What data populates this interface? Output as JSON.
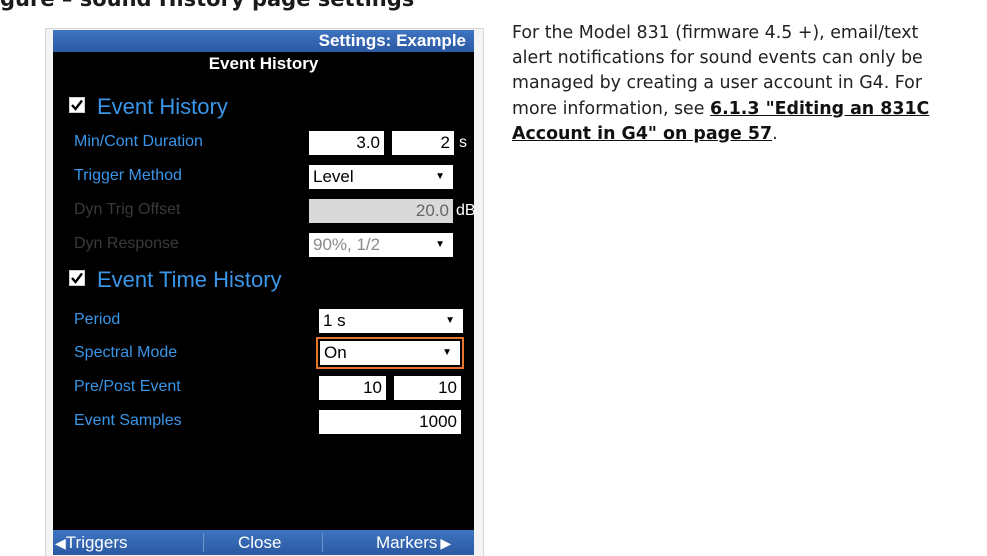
{
  "heading_fragment": "gure  –  sound  History page settings",
  "device": {
    "title": "Settings: Example",
    "subtitle": "Event History",
    "event_history": {
      "section_label": "Event History",
      "checked": true,
      "min_cont_duration": {
        "label": "Min/Cont Duration",
        "value1": "3.0",
        "value2": "2",
        "unit": "s"
      },
      "trigger_method": {
        "label": "Trigger Method",
        "value": "Level"
      },
      "dyn_trig_offset": {
        "label": "Dyn Trig Offset",
        "value": "20.0",
        "unit": "dB"
      },
      "dyn_response": {
        "label": "Dyn Response",
        "value": "90%, 1/2"
      }
    },
    "event_time_history": {
      "section_label": "Event Time History",
      "checked": true,
      "period": {
        "label": "Period",
        "value": "1 s"
      },
      "spectral_mode": {
        "label": "Spectral Mode",
        "value": "On"
      },
      "pre_post_event": {
        "label": "Pre/Post Event",
        "value1": "10",
        "value2": "10"
      },
      "event_samples": {
        "label": "Event Samples",
        "value": "1000"
      }
    },
    "bottom_bar": {
      "left": "Triggers",
      "center": "Close",
      "right": "Markers"
    }
  },
  "description": {
    "text": "For the Model 831 (firmware 4.5 +), email/text alert notifications for sound events can only be managed by creating a user account in G4. For more information, see ",
    "link": "6.1.3 \"Editing an 831C Account in G4\" on page 57",
    "end": "."
  },
  "colors": {
    "accent_blue": "#3a96e8",
    "titlebar_blue": "#2b59a3",
    "highlight_orange": "#e8752c"
  }
}
